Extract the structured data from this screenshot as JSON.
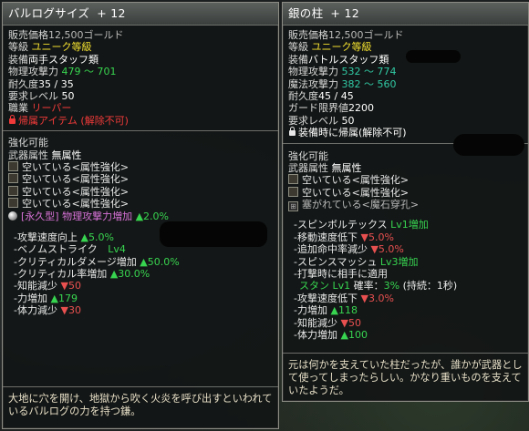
{
  "left": {
    "title": "バルログサイズ",
    "enhance": "+ 12",
    "price_label": "販売価格",
    "price_value": "12,500ゴールド",
    "grade_label": "等級",
    "grade_value": "ユニーク等級",
    "equip_label": "装備",
    "equip_value": "両手スタッフ類",
    "phys_atk_label": "物理攻撃力",
    "phys_atk_value": "479 ～ 701",
    "durability_label": "耐久度",
    "durability_value": "35 / 35",
    "req_level_label": "要求レベル",
    "req_level_value": "50",
    "job_label": "職業",
    "job_value": "リーパー",
    "bind_text": "帰属アイテム (解除不可)",
    "enhance_header": "強化可能",
    "weapon_attr_label": "武器属性",
    "weapon_attr_value": "無属性",
    "slots": [
      "空いている<属性強化>",
      "空いている<属性強化>",
      "空いている<属性強化>",
      "空いている<属性強化>"
    ],
    "perm_gem_label": "[永久型]",
    "perm_gem_effect": "物理攻撃力増加",
    "perm_gem_value": "▲2.0%",
    "bonuses": [
      {
        "label": "-攻撃速度向上",
        "value": "▲5.0%",
        "dir": "up"
      },
      {
        "label": "-ベノムストライク",
        "value": "Lv4",
        "dir": "up"
      },
      {
        "label": "-クリティカルダメージ増加",
        "value": "▲50.0%",
        "dir": "up"
      },
      {
        "label": "-クリティカル率増加",
        "value": "▲30.0%",
        "dir": "up"
      },
      {
        "label": "-知能減少",
        "value": "▼50",
        "dir": "down"
      },
      {
        "label": "-力増加",
        "value": "▲179",
        "dir": "up"
      },
      {
        "label": "-体力減少",
        "value": "▼30",
        "dir": "down"
      }
    ],
    "flavor": "大地に穴を開け、地獄から吹く火炎を呼び出すといわれているバルログの力を持つ鎌。"
  },
  "right": {
    "title": "銀の柱",
    "enhance": "+ 12",
    "price_label": "販売価格",
    "price_value": "12,500ゴールド",
    "grade_label": "等級",
    "grade_value": "ユニーク等級",
    "equip_label": "装備",
    "equip_value": "バトルスタッフ類",
    "phys_atk_label": "物理攻撃力",
    "phys_atk_value": "532 ～ 774",
    "mag_atk_label": "魔法攻撃力",
    "mag_atk_value": "382 ～ 560",
    "durability_label": "耐久度",
    "durability_value": "45 / 45",
    "guard_label": "ガード限界値",
    "guard_value": "2200",
    "req_level_label": "要求レベル",
    "req_level_value": "50",
    "bind_text": "装備時に帰属(解除不可)",
    "enhance_header": "強化可能",
    "weapon_attr_label": "武器属性",
    "weapon_attr_value": "無属性",
    "slots": [
      "空いている<属性強化>",
      "空いている<属性強化>"
    ],
    "sealed_slot": "塞がれている<魔石穿孔>",
    "bonus_1": {
      "label": "-スピンボルテックス",
      "value": "Lv1増加"
    },
    "bonus_2": {
      "label": "-移動速度低下",
      "value": "▼5.0%"
    },
    "bonus_3": {
      "label": "-追加命中率減少",
      "value": "▼5.0%"
    },
    "bonus_4": {
      "label": "-スピンスマッシュ",
      "value": "Lv3増加"
    },
    "bonus_5": {
      "label": "-打撃時に相手に適用"
    },
    "stun": {
      "name": "スタン",
      "level": "Lv1",
      "rate_label": "確率：",
      "rate_value": "3%",
      "duration": "(持続：1秒)"
    },
    "bonus_6": {
      "label": "-攻撃速度低下",
      "value": "▼3.0%"
    },
    "bonus_7": {
      "label": "-力増加",
      "value": "▲118"
    },
    "bonus_8": {
      "label": "-知能減少",
      "value": "▼50"
    },
    "bonus_9": {
      "label": "-体力増加",
      "value": "▲100"
    },
    "flavor": "元は何かを支えていた柱だったが、誰かが武器として使ってしまったらしい。かなり重いものを支えていたようだ。"
  }
}
